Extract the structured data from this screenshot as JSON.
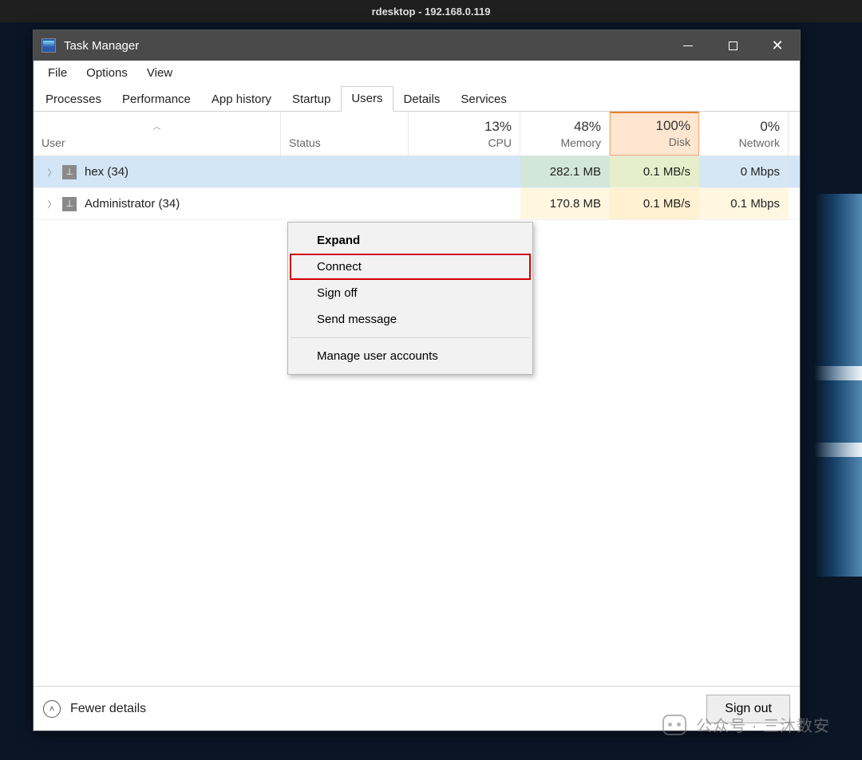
{
  "desktop_title": "rdesktop - 192.168.0.119",
  "window": {
    "title": "Task Manager"
  },
  "menu": {
    "file": "File",
    "options": "Options",
    "view": "View"
  },
  "tabs": {
    "processes": "Processes",
    "performance": "Performance",
    "app_history": "App history",
    "startup": "Startup",
    "users": "Users",
    "details": "Details",
    "services": "Services"
  },
  "headers": {
    "user": "User",
    "status": "Status",
    "cpu": {
      "pct": "13%",
      "label": "CPU"
    },
    "memory": {
      "pct": "48%",
      "label": "Memory"
    },
    "disk": {
      "pct": "100%",
      "label": "Disk"
    },
    "network": {
      "pct": "0%",
      "label": "Network"
    }
  },
  "rows": [
    {
      "name": "hex (34)",
      "memory": "282.1 MB",
      "disk": "0.1 MB/s",
      "network": "0 Mbps"
    },
    {
      "name": "Administrator (34)",
      "memory": "170.8 MB",
      "disk": "0.1 MB/s",
      "network": "0.1 Mbps"
    }
  ],
  "context_menu": {
    "expand": "Expand",
    "connect": "Connect",
    "sign_off": "Sign off",
    "send_message": "Send message",
    "manage": "Manage user accounts"
  },
  "footer": {
    "fewer": "Fewer details",
    "signout": "Sign out"
  },
  "watermark": "公众号 · 三沐数安"
}
